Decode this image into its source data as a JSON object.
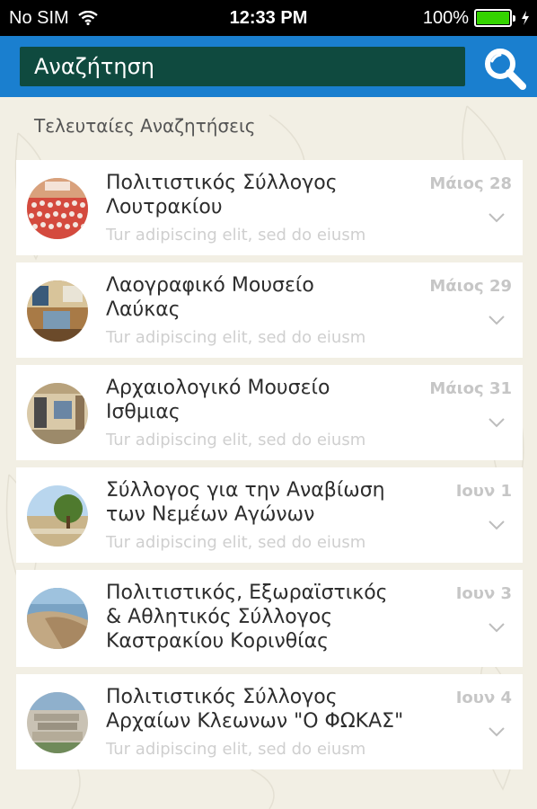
{
  "status_bar": {
    "carrier": "No SIM",
    "time": "12:33 PM",
    "battery": "100%",
    "battery_level": 1.0,
    "colors": {
      "battery_fill": "#34d300"
    }
  },
  "navbar": {
    "search_label": "Αναζήτηση",
    "search_icon": "search-icon",
    "colors": {
      "bar": "#1a7fcf",
      "field": "#0f4a3f"
    }
  },
  "section_title": "Τελευταίες Αναζητήσεις",
  "items": [
    {
      "title": "Πολιτιστικός Σύλλογος\nΛουτρακίου",
      "subtitle": "Tur adipiscing elit, sed do eiusm",
      "date": "Μάιος 28",
      "image": "choir-photo"
    },
    {
      "title": "Λαογραφικό Μουσείο\nΛαύκας",
      "subtitle": "Tur adipiscing elit, sed do eiusm",
      "date": "Μάιος 29",
      "image": "museum-interior-photo"
    },
    {
      "title": "Αρχαιολογικό Μουσείο\nΙσθμιας",
      "subtitle": "Tur adipiscing elit, sed do eiusm",
      "date": "Μάιος 31",
      "image": "museum-hall-photo"
    },
    {
      "title": "Σύλλογος για την Αναβίωση\nτων Νεμέων Αγώνων",
      "subtitle": "Tur adipiscing elit, sed do eiusm",
      "date": "Ιουν 1",
      "image": "stadium-tree-photo"
    },
    {
      "title": "Πολιτιστικός, Εξωραϊστικός\n& Αθλητικός Σύλλογος\nΚαστρακίου Κορινθίας",
      "subtitle": "",
      "date": "Ιουν 3",
      "image": "coast-photo"
    },
    {
      "title": "Πολιτιστικός Σύλλογος\nΑρχαίων Κλεωνων \"Ο ΦΩΚΑΣ\"",
      "subtitle": "Tur adipiscing elit, sed do eiusm",
      "date": "Ιουν 4",
      "image": "ruins-photo"
    }
  ]
}
